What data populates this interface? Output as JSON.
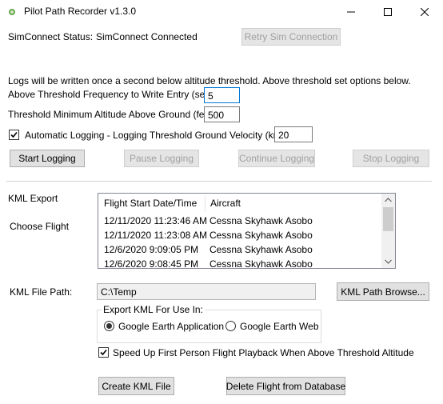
{
  "window": {
    "title": "Pilot Path Recorder v1.3.0",
    "minimize_glyph": "–",
    "maximize_glyph": "☐",
    "close_glyph": "✕"
  },
  "simconnect": {
    "status_label": "SimConnect Status:",
    "status_value": "SimConnect Connected",
    "retry_button": "Retry Sim Connection"
  },
  "logging": {
    "description": "Logs will be written once a second below altitude threshold.  Above threshold set options below.",
    "frequency_label": "Above Threshold Frequency to Write Entry (secs):",
    "frequency_value": "5",
    "min_altitude_label": "Threshold Minimum Altitude Above Ground (feet):",
    "min_altitude_value": "500",
    "auto_logging_label": "Automatic Logging - Logging Threshold Ground Velocity (knots):",
    "auto_logging_checked": true,
    "velocity_value": "20",
    "start_button": "Start Logging",
    "pause_button": "Pause Logging",
    "continue_button": "Continue Logging",
    "stop_button": "Stop Logging"
  },
  "kml": {
    "section_label": "KML Export",
    "choose_flight_label": "Choose Flight",
    "columns": [
      "Flight Start Date/Time",
      "Aircraft"
    ],
    "flights": [
      {
        "datetime": "12/11/2020 11:23:46 AM",
        "aircraft": "Cessna Skyhawk Asobo"
      },
      {
        "datetime": "12/11/2020 11:23:08 AM",
        "aircraft": "Cessna Skyhawk Asobo"
      },
      {
        "datetime": "12/6/2020 9:09:05 PM",
        "aircraft": "Cessna Skyhawk Asobo"
      },
      {
        "datetime": "12/6/2020 9:08:45 PM",
        "aircraft": "Cessna Skyhawk Asobo"
      }
    ],
    "file_path_label": "KML File Path:",
    "file_path_value": "C:\\Temp",
    "browse_button": "KML Path Browse...",
    "export_group_label": "Export KML For Use In:",
    "option_app": "Google Earth Application",
    "option_web": "Google Earth Web",
    "selected_option": "Google Earth Application",
    "speedup_label": "Speed Up First Person Flight Playback When Above Threshold Altitude",
    "speedup_checked": true,
    "create_button": "Create KML File",
    "delete_button": "Delete Flight from Database"
  }
}
